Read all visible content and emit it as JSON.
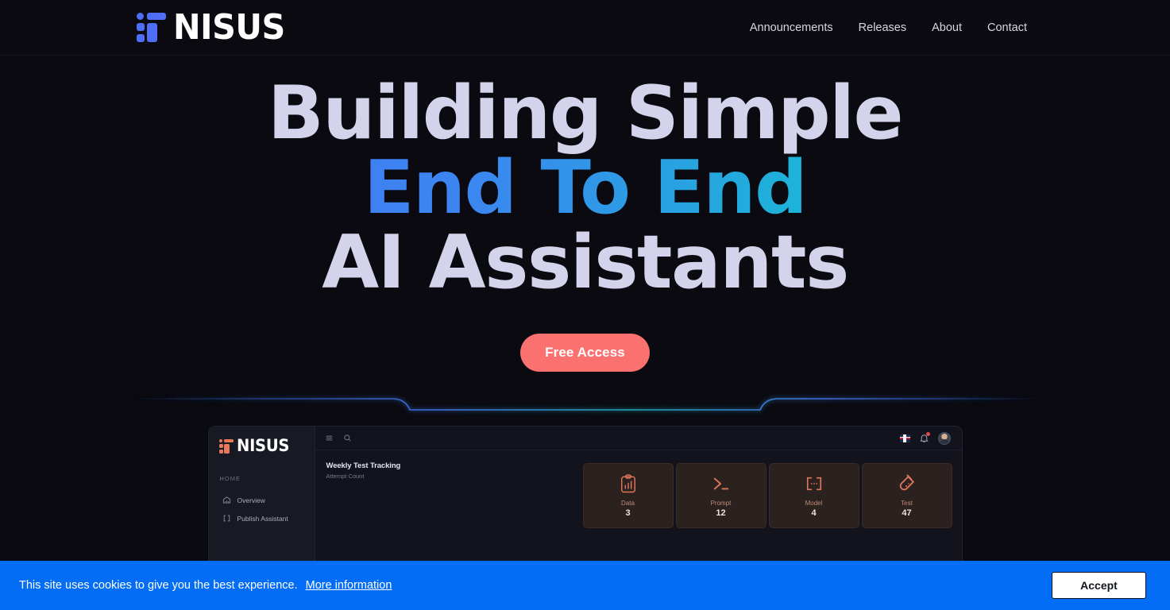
{
  "brand": {
    "name": "NISUS",
    "mark": "nisus-grid-logo",
    "mark_color": "#4f6ef7"
  },
  "nav": {
    "items": [
      {
        "label": "Announcements"
      },
      {
        "label": "Releases"
      },
      {
        "label": "About"
      },
      {
        "label": "Contact"
      }
    ]
  },
  "hero": {
    "line1": "Building Simple",
    "line2": "End To End",
    "line3": "AI Assistants",
    "line2_gradient_from": "#4a6ef5",
    "line2_gradient_to": "#14c9c1",
    "cta_label": "Free Access",
    "cta_color": "#fa716f"
  },
  "dashboard": {
    "brand_name": "NISUS",
    "brand_color": "#e8775c",
    "sidebar": {
      "section_label": "HOME",
      "items": [
        {
          "label": "Overview",
          "icon": "overview-icon"
        },
        {
          "label": "Publish Assistant",
          "icon": "brackets-icon"
        }
      ]
    },
    "topbar": {
      "menu_icon": "hamburger-icon",
      "search_icon": "search-icon",
      "flag_icon": "uk-flag-icon",
      "bell_icon": "notification-bell-icon",
      "avatar": "user-avatar"
    },
    "chart": {
      "title": "Weekly Test Tracking",
      "subtitle": "Attempt Count"
    },
    "stat_cards": [
      {
        "label": "Data",
        "value": "3",
        "icon": "clipboard-chart-icon"
      },
      {
        "label": "Prompt",
        "value": "12",
        "icon": "terminal-icon"
      },
      {
        "label": "Model",
        "value": "4",
        "icon": "brackets-dots-icon"
      },
      {
        "label": "Test",
        "value": "47",
        "icon": "test-tube-icon"
      }
    ]
  },
  "cookie": {
    "message": "This site uses cookies to give you the best experience.",
    "link_label": "More information",
    "accept_label": "Accept",
    "background": "#036df5"
  }
}
